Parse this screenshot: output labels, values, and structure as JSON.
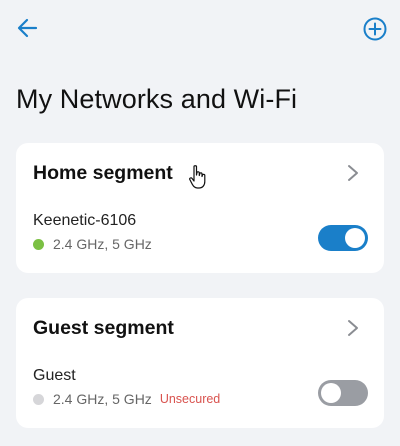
{
  "header": {
    "back_icon": "arrow-left-icon",
    "add_icon": "plus-circle-icon",
    "accent_color": "#1a7fc9"
  },
  "page": {
    "title": "My Networks and Wi-Fi"
  },
  "segments": [
    {
      "title": "Home segment",
      "network": "Keenetic-6106",
      "bands": "2.4 GHz, 5 GHz",
      "status_color": "#7bc043",
      "enabled": true,
      "secured_label": ""
    },
    {
      "title": "Guest segment",
      "network": "Guest",
      "bands": "2.4 GHz, 5 GHz",
      "status_color": "#d6d6d9",
      "enabled": false,
      "secured_label": "Unsecured"
    }
  ],
  "colors": {
    "toggle_on": "#1a7fc9",
    "toggle_off": "#9a9da3",
    "unsecured": "#d9534f"
  }
}
